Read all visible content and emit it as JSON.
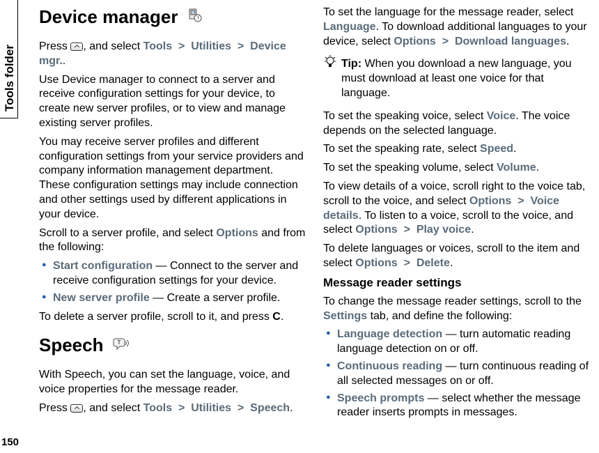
{
  "sideTab": "Tools folder",
  "pageNumber": "150",
  "dm": {
    "title": "Device manager",
    "p1a": "Press ",
    "p1b": ", and select ",
    "nav1": "Tools",
    "sep": ">",
    "nav2": "Utilities",
    "nav3": "Device mgr.",
    "p1c": ".",
    "p2": "Use Device manager to connect to a server and receive configuration settings for your device, to create new server profiles, or to view and manage existing server profiles.",
    "p3": "You may receive server profiles and different configuration settings from your service providers and company information management department. These configuration settings may include connection and other settings used by different applications in your device.",
    "p4a": "Scroll to a server profile, and select ",
    "p4opt": "Options",
    "p4b": " and from the following:",
    "b1name": "Start configuration",
    "b1desc": " — Connect to the server and receive configuration settings for your device.",
    "b2name": "New server profile",
    "b2desc": " — Create a server profile.",
    "p5a": "To delete a server profile, scroll to it, and press ",
    "p5key": "C",
    "p5b": "."
  },
  "sp": {
    "title": "Speech",
    "p1": "With Speech, you can set the language, voice, and voice properties for the message reader.",
    "p2a": "Press ",
    "p2b": ", and select ",
    "nav1": "Tools",
    "nav2": "Utilities",
    "nav3": "Speech",
    "p2c": ".",
    "p3a": "To set the language for the message reader, select ",
    "lang": "Language",
    "p3b": ". To download additional languages to your device, select ",
    "opt": "Options",
    "dl": "Download languages",
    "p3c": ".",
    "tipLabel": "Tip:",
    "tipText": " When you download a new language, you must download at least one voice for that language.",
    "p4a": "To set the speaking voice, select ",
    "voice": "Voice",
    "p4b": ". The voice depends on the selected language.",
    "p5a": "To set the speaking rate, select ",
    "speed": "Speed",
    "p5b": ".",
    "p6a": "To set the speaking volume, select ",
    "volume": "Volume",
    "p6b": ".",
    "p7a": "To view details of a voice, scroll right to the voice tab, scroll to the voice, and select ",
    "vd": "Voice details",
    "p7b": ". To listen to a voice, scroll to the voice, and select ",
    "pv": "Play voice",
    "p7c": ".",
    "p8a": "To delete languages or voices, scroll to the item and select ",
    "del": "Delete",
    "p8b": ".",
    "h2": "Message reader settings",
    "p9a": "To change the message reader settings, scroll to the ",
    "settings": "Settings",
    "p9b": " tab, and define the following:",
    "s1name": "Language detection",
    "s1desc": " — turn automatic reading language detection on or off.",
    "s2name": "Continuous reading",
    "s2desc": " — turn continuous reading of all selected messages on or off.",
    "s3name": "Speech prompts",
    "s3desc": " — select whether the message reader inserts prompts in messages."
  }
}
